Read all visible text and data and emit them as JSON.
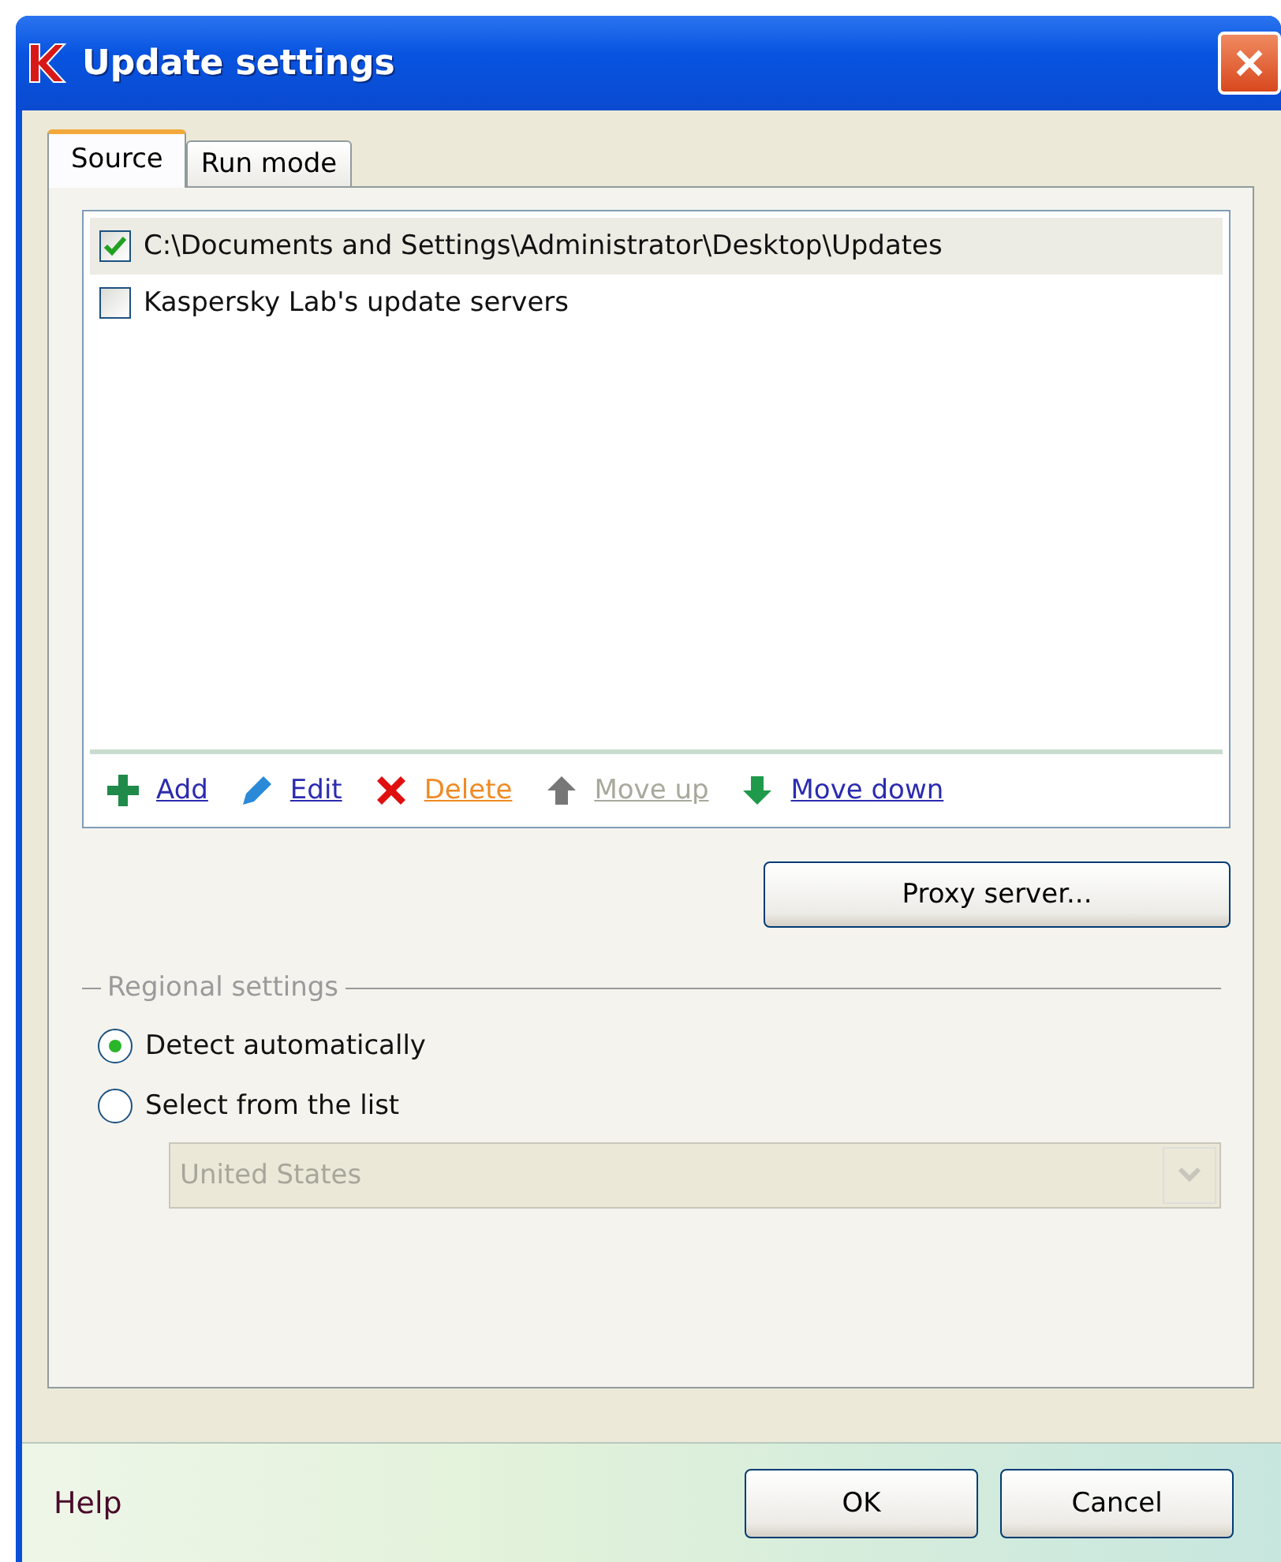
{
  "window": {
    "title": "Update settings"
  },
  "tabs": [
    {
      "label": "Source",
      "selected": true
    },
    {
      "label": "Run mode",
      "selected": false
    }
  ],
  "sources": [
    {
      "label": "C:\\Documents and Settings\\Administrator\\Desktop\\Updates",
      "checked": true,
      "selected": true
    },
    {
      "label": "Kaspersky Lab's update servers",
      "checked": false,
      "selected": false
    }
  ],
  "actions": [
    {
      "kind": "add",
      "label": "Add",
      "color": "#2b2bb0"
    },
    {
      "kind": "edit",
      "label": "Edit",
      "color": "#2b2bb0"
    },
    {
      "kind": "delete",
      "label": "Delete",
      "color": "#f08a24"
    },
    {
      "kind": "up",
      "label": "Move up",
      "color": "#a8a89c"
    },
    {
      "kind": "down",
      "label": "Move down",
      "color": "#2b2bb0"
    }
  ],
  "proxy_button": "Proxy server...",
  "regional": {
    "title": "Regional settings",
    "options": [
      {
        "label": "Detect automatically",
        "selected": true
      },
      {
        "label": "Select from the list",
        "selected": false
      }
    ],
    "country": {
      "value": "United States",
      "disabled": true
    }
  },
  "footer": {
    "help": "Help",
    "buttons": [
      "OK",
      "Cancel"
    ]
  }
}
